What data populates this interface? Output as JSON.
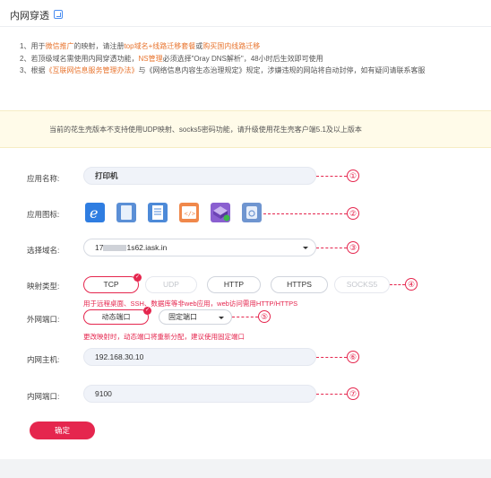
{
  "header": {
    "title": "内网穿透"
  },
  "notice": {
    "line1_prefix": "1、用于",
    "line1_hl1": "微信推广",
    "line1_mid": "的映射，请注册",
    "line1_hl2": "top域名+线路迁移套餐",
    "line1_mid2": "或",
    "line1_hl3": "购买国内线路迁移",
    "line2_prefix": "2、若顶级域名需使用内网穿透功能，",
    "line2_hl": "NS管理",
    "line2_suffix": "必须选择\"Oray DNS解析\"，48小时后生效即可使用",
    "line3_prefix": "3、根据",
    "line3_hl": "《互联网信息服务管理办法》",
    "line3_suffix": "与《网络信息内容生态治理规定》规定，涉嫌违规的网站将自动封停，如有疑问请联系客服"
  },
  "warning": "当前的花生壳版本不支持使用UDP映射、socks5密码功能，请升级使用花生壳客户端5.1及以上版本",
  "form": {
    "app_name_label": "应用名称:",
    "app_name_value": "打印机",
    "app_icon_label": "应用图标:",
    "domain_label": "选择域名:",
    "domain_prefix": "17",
    "domain_suffix": "1s62.iask.in",
    "type_label": "映射类型:",
    "types": [
      "TCP",
      "UDP",
      "HTTP",
      "HTTPS",
      "SOCKS5"
    ],
    "type_hint": "用于远程桌面、SSH、数据库等非web应用，web访问需用HTTP/HTTPS",
    "port_label": "外网端口:",
    "port_dynamic": "动态端口",
    "port_fixed": "固定端口",
    "port_hint": "更改映射时，动态端口将重新分配，建议使用固定端口",
    "host_label": "内网主机:",
    "host_value": "192.168.30.10",
    "inner_port_label": "内网端口:",
    "inner_port_value": "9100",
    "submit": "确定"
  },
  "markers": [
    "①",
    "②",
    "③",
    "④",
    "⑤",
    "⑥",
    "⑦"
  ],
  "colors": {
    "accent": "#e5264e",
    "highlight": "#e8742e",
    "warning_bg": "#fffbe9"
  }
}
